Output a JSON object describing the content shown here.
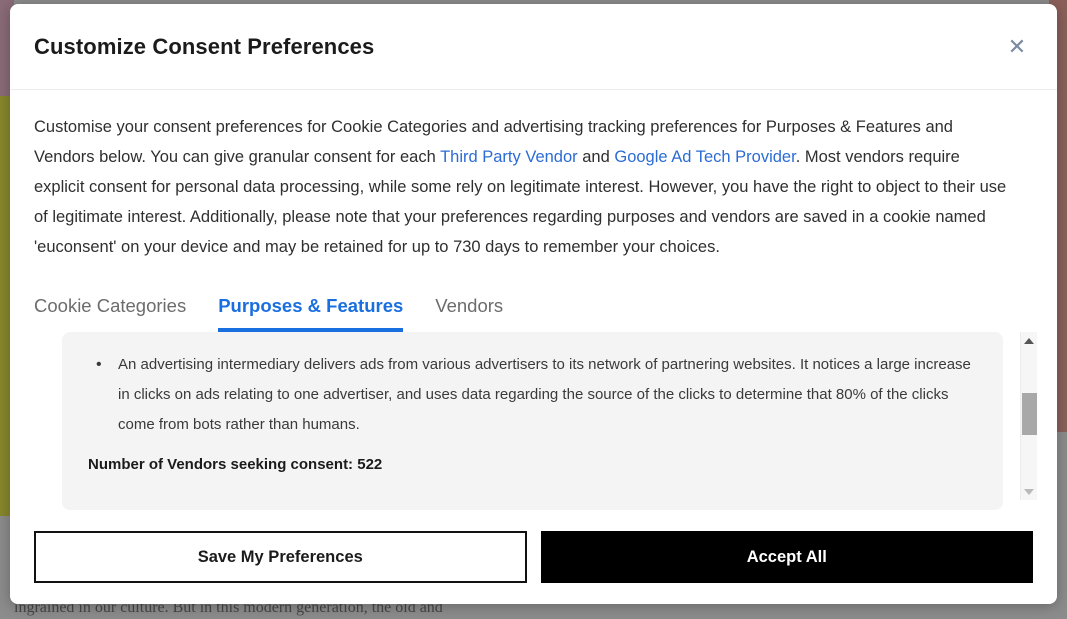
{
  "background": {
    "page_text_snippet": "ingrained in our culture. But in this modern generation, the old and",
    "band_mauve_color": "#8a6b78",
    "band_olive_color": "#87872c",
    "band_rose_color": "#8b605a",
    "overlay_color": "#8c8c8c"
  },
  "modal": {
    "title": "Customize Consent Preferences",
    "close_icon": "close-icon",
    "close_glyph": "✕",
    "intro": {
      "part1": "Customise your consent preferences for Cookie Categories and advertising tracking preferences for Purposes & Features and Vendors below. You can give granular consent for each ",
      "link1": "Third Party Vendor",
      "part2": " and ",
      "link2": "Google Ad Tech Provider",
      "part3": ". Most vendors require explicit consent for personal data processing, while some rely on legitimate interest. However, you have the right to object to their use of legitimate interest. Additionally, please note that your preferences regarding purposes and vendors are saved in a cookie named 'euconsent' on your device and may be retained for up to 730 days to remember your choices.",
      "link_color": "#2b6cd4"
    },
    "tabs": [
      {
        "label": "Cookie Categories",
        "active": false
      },
      {
        "label": "Purposes & Features",
        "active": true
      },
      {
        "label": "Vendors",
        "active": false
      }
    ],
    "active_tab_color": "#1a6fe0",
    "panel": {
      "bullets": [
        "An advertising intermediary delivers ads from various advertisers to its network of partnering websites. It notices a large increase in clicks on ads relating to one advertiser, and uses data regarding the source of the clicks to determine that 80% of the clicks come from bots rather than humans."
      ],
      "vendor_count_label": "Number of Vendors seeking consent: 522"
    },
    "scrollbar": {
      "up_icon": "chevron-up-icon",
      "down_icon": "chevron-down-icon",
      "thumb_color": "#a8a8a8"
    },
    "footer": {
      "save_label": "Save My Preferences",
      "accept_label": "Accept All",
      "accept_bg": "#000000"
    }
  }
}
